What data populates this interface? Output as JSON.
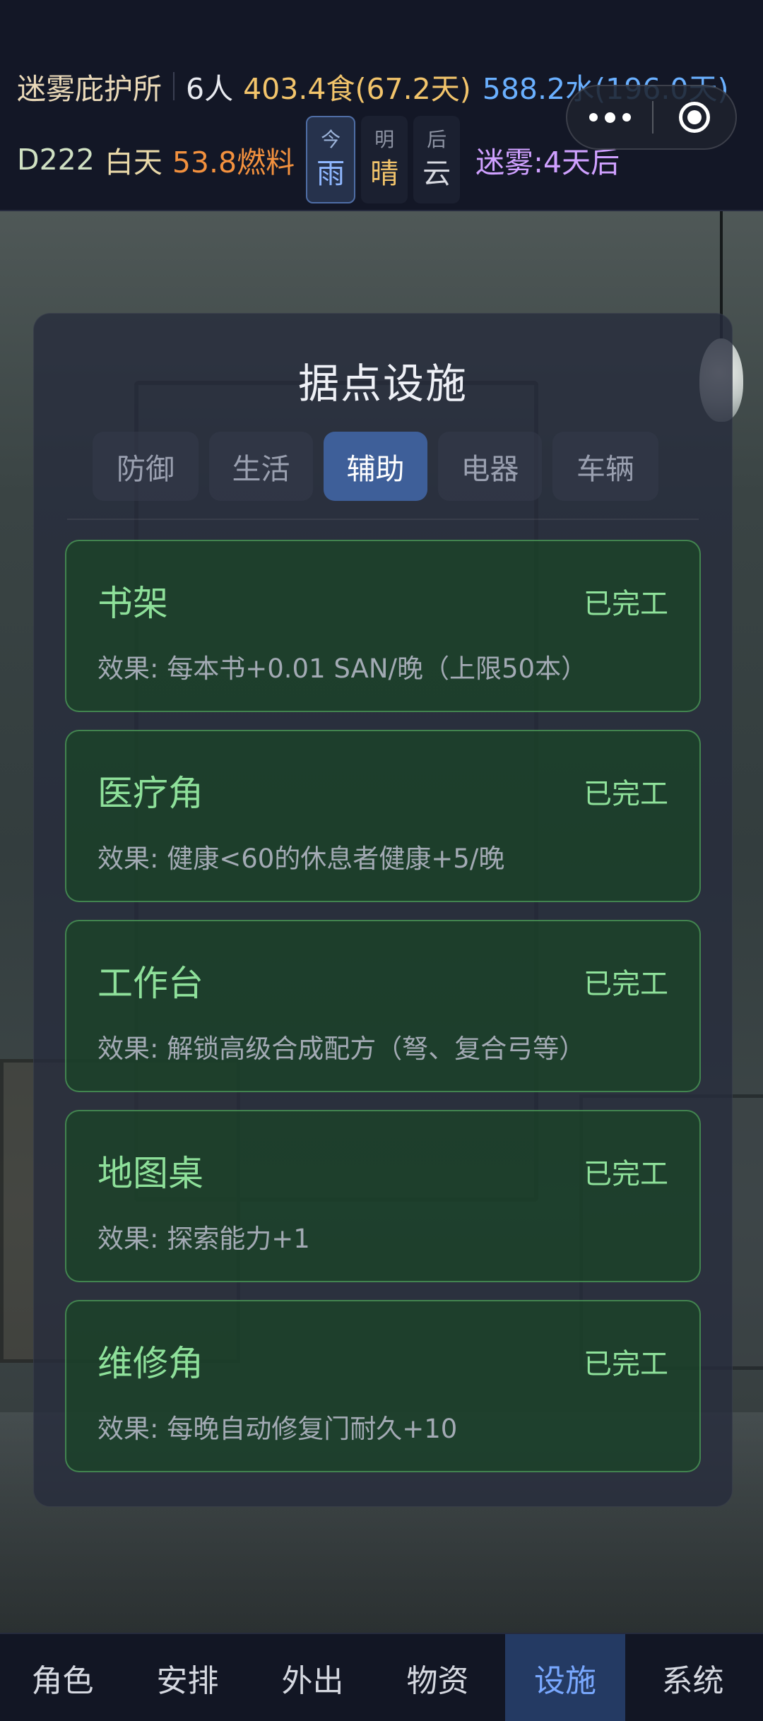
{
  "header": {
    "shelter_name": "迷雾庇护所",
    "people": "6人",
    "food": "403.4食(67.2天)",
    "water": "588.2水(196.0天)",
    "day": "D222",
    "daytime": "白天",
    "fuel": "53.8燃料",
    "weather": [
      {
        "label": "今",
        "value": "雨",
        "active": true
      },
      {
        "label": "明",
        "value": "晴",
        "active": false
      },
      {
        "label": "后",
        "value": "云",
        "active": false
      }
    ],
    "fog": "迷雾:4天后"
  },
  "panel": {
    "title": "据点设施",
    "tabs": [
      {
        "label": "防御",
        "active": false
      },
      {
        "label": "生活",
        "active": false
      },
      {
        "label": "辅助",
        "active": true
      },
      {
        "label": "电器",
        "active": false
      },
      {
        "label": "车辆",
        "active": false
      }
    ],
    "cards": [
      {
        "name": "书架",
        "status": "已完工",
        "effect": "效果: 每本书+0.01 SAN/晚（上限50本）"
      },
      {
        "name": "医疗角",
        "status": "已完工",
        "effect": "效果: 健康<60的休息者健康+5/晚"
      },
      {
        "name": "工作台",
        "status": "已完工",
        "effect": "效果: 解锁高级合成配方（弩、复合弓等）"
      },
      {
        "name": "地图桌",
        "status": "已完工",
        "effect": "效果: 探索能力+1"
      },
      {
        "name": "维修角",
        "status": "已完工",
        "effect": "效果: 每晚自动修复门耐久+10"
      }
    ]
  },
  "bottom_nav": [
    {
      "label": "角色",
      "active": false
    },
    {
      "label": "安排",
      "active": false
    },
    {
      "label": "外出",
      "active": false
    },
    {
      "label": "物资",
      "active": false
    },
    {
      "label": "设施",
      "active": true
    },
    {
      "label": "系统",
      "active": false
    }
  ],
  "icons": {
    "more": "more-dots-icon",
    "close": "close-circle-icon",
    "bulb": "light-bulb"
  },
  "colors": {
    "food": "#f2c46b",
    "water": "#6ab0ff",
    "fuel": "#f3913e",
    "fog": "#cfa0ff",
    "completed": "#8ee09a",
    "active_tab": "#3e5f99"
  }
}
